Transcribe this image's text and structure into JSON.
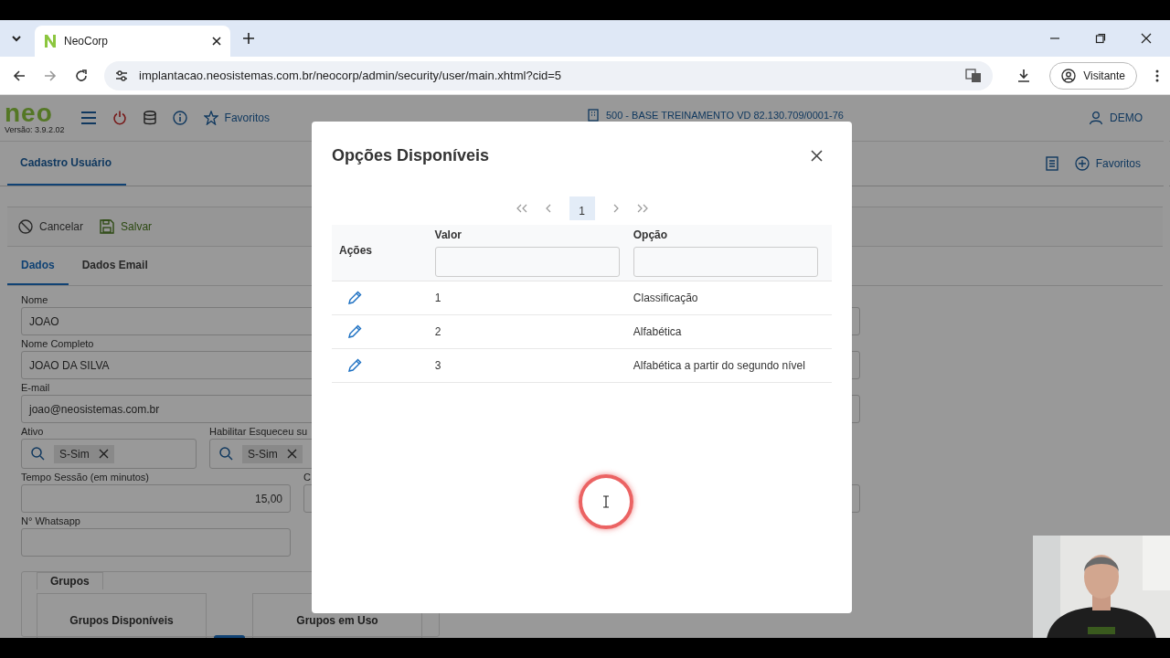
{
  "browser": {
    "tab_title": "NeoCorp",
    "url": "implantacao.neosistemas.com.br/neocorp/admin/security/user/main.xhtml?cid=5",
    "profile": "Visitante"
  },
  "app": {
    "logo": "neo",
    "version": "Versão: 3.9.2.02",
    "favorites": "Favoritos",
    "company": "500 - BASE TREINAMENTO VD 82.130.709/0001-76",
    "user": "DEMO",
    "page_tab": "Cadastro Usuário",
    "page_favorites": "Favoritos",
    "toolbar": [
      {
        "kind": "cancel",
        "label": "Cancelar"
      },
      {
        "kind": "save",
        "label": "Salvar"
      }
    ],
    "tabs": [
      {
        "label": "Dados",
        "selected": true
      },
      {
        "label": "Dados Email",
        "selected": false
      }
    ],
    "form_rows": [
      [
        {
          "kind": "text",
          "label": "Nome",
          "value": "JOAO"
        }
      ],
      [
        {
          "kind": "text",
          "label": "Nome Completo",
          "value": "JOAO DA SILVA"
        }
      ],
      [
        {
          "kind": "text",
          "label": "E-mail",
          "value": "joao@neosistemas.com.br"
        }
      ],
      [
        {
          "kind": "lookup",
          "label": "Ativo",
          "value": "S-Sim"
        },
        {
          "kind": "lookup",
          "label": "Habilitar Esqueceu su",
          "value": "S-Sim"
        }
      ],
      [
        {
          "kind": "number",
          "label": "Tempo Sessão (em minutos)",
          "value": "15,00"
        },
        {
          "kind": "text",
          "label": "C"
        }
      ],
      [
        {
          "kind": "short",
          "label": "N° Whatsapp"
        }
      ]
    ],
    "groups": {
      "legend": "Grupos",
      "panels": [
        "Grupos Disponíveis",
        "Grupos em Uso"
      ]
    }
  },
  "dialog": {
    "title": "Opções Disponíveis",
    "pages": [
      {
        "label": "1",
        "selected": true
      }
    ],
    "columns": [
      "Ações",
      "Valor",
      "Opção"
    ],
    "rows": [
      {
        "valor": "1",
        "opcao": "Classificação"
      },
      {
        "valor": "2",
        "opcao": "Alfabética"
      },
      {
        "valor": "3",
        "opcao": "Alfabética a partir do segundo nível"
      }
    ]
  }
}
